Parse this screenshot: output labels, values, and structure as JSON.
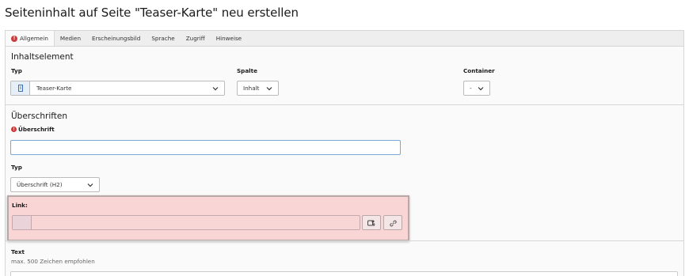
{
  "page": {
    "title": "Seiteninhalt auf Seite \"Teaser-Karte\" neu erstellen"
  },
  "tabs": [
    {
      "label": "Allgemein",
      "active": true,
      "error": true
    },
    {
      "label": "Medien"
    },
    {
      "label": "Erscheinungsbild"
    },
    {
      "label": "Sprache"
    },
    {
      "label": "Zugriff"
    },
    {
      "label": "Hinweise"
    }
  ],
  "error_marker": "!",
  "content_element": {
    "section_title": "Inhaltselement",
    "type": {
      "label": "Typ",
      "value": "Teaser-Karte",
      "icon": "content-element-icon"
    },
    "column": {
      "label": "Spalte",
      "value": "Inhalt"
    },
    "container": {
      "label": "Container",
      "value": "-"
    }
  },
  "headings": {
    "section_title": "Überschriften",
    "heading": {
      "label": "Überschrift",
      "value": "",
      "required": true
    },
    "heading_type": {
      "label": "Typ",
      "value": "Überschrift (H2)"
    },
    "link": {
      "label": "Link:",
      "value": "",
      "wizard_icon": "link-browser-icon",
      "link_icon": "chain-link-icon"
    }
  },
  "text": {
    "label": "Text",
    "hint": "max. 500 Zeichen empfohlen"
  },
  "colors": {
    "error": "#c83c3c",
    "highlight": "#f9d5d5",
    "focus_border": "#7aa8d8"
  }
}
